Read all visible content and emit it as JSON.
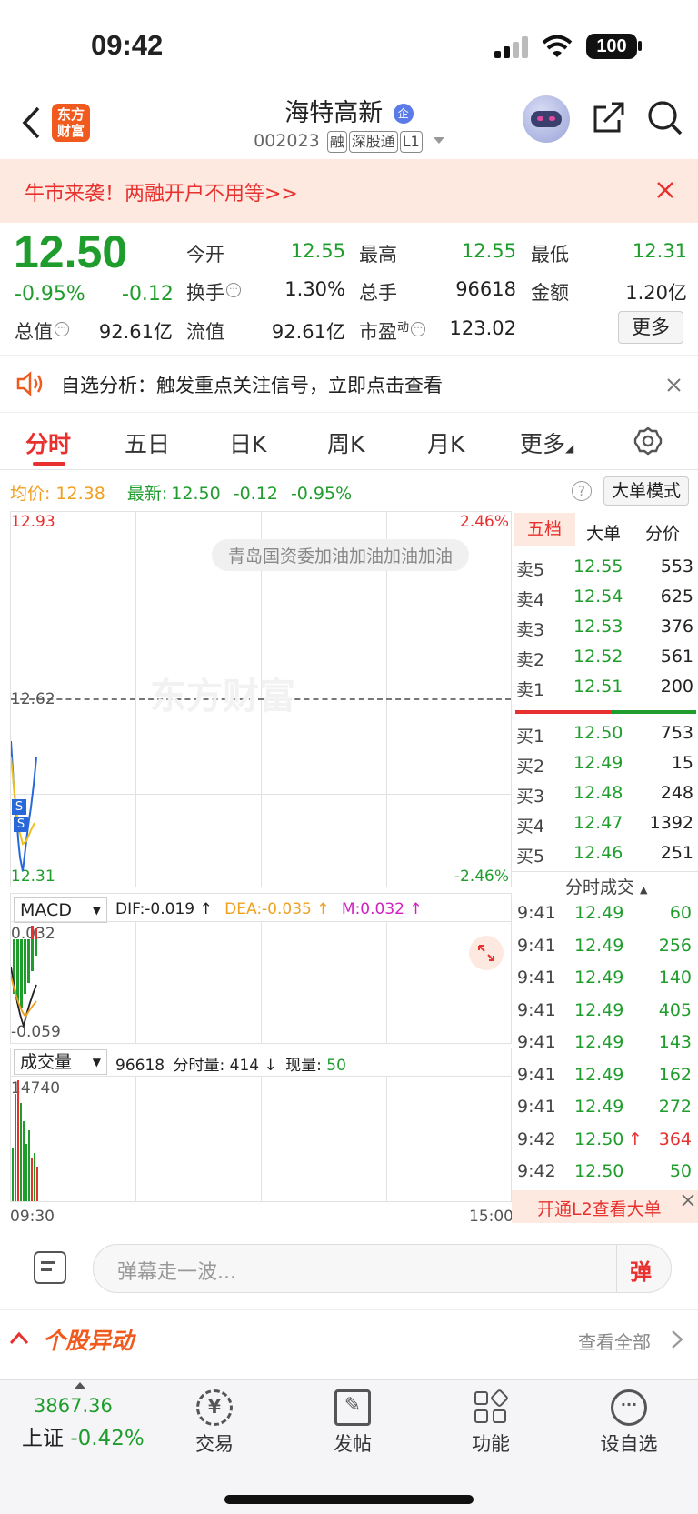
{
  "status": {
    "time": "09:42",
    "battery": "100"
  },
  "header": {
    "logo_line1": "东方",
    "logo_line2": "财富",
    "stock_name": "海特高新",
    "code": "002023",
    "tags": [
      "融",
      "深股通",
      "L1"
    ]
  },
  "banner": {
    "text": "牛市来袭！两融开户不用等>>"
  },
  "quote": {
    "price": "12.50",
    "change_pct": "-0.95%",
    "change_amt": "-0.12",
    "labels": {
      "open": "今开",
      "high": "最高",
      "low": "最低",
      "turnover": "换手",
      "volume": "总手",
      "amount": "金额",
      "mcap": "总值",
      "float_mcap": "流值",
      "pe": "市盈",
      "pe_sup": "动"
    },
    "open": "12.55",
    "high": "12.55",
    "low": "12.31",
    "turnover": "1.30%",
    "volume": "96618",
    "amount": "1.20亿",
    "mcap": "92.61亿",
    "float_mcap": "92.61亿",
    "pe": "123.02",
    "more_button": "更多"
  },
  "notice": {
    "text": "自选分析：触发重点关注信号，立即点击查看"
  },
  "tabs": [
    "分时",
    "五日",
    "日K",
    "周K",
    "月K",
    "更多"
  ],
  "chart_info": {
    "avg_label": "均价:",
    "avg_value": "12.38",
    "latest_label": "最新:",
    "latest_value": "12.50",
    "latest_change": "-0.12",
    "latest_pct": "-0.95%",
    "big_order_mode": "大单模式",
    "y_top": "12.93",
    "y_mid": "12.62",
    "y_bottom": "12.31",
    "pct_top": "2.46%",
    "pct_bottom": "-2.46%",
    "danmaku": "青岛国资委加油加油加油加油",
    "watermark": "东方财富",
    "time_start": "09:30",
    "time_end": "15:00"
  },
  "macd": {
    "selector": "MACD",
    "dif": "DIF:-0.019 ↑",
    "dea": "DEA:-0.035 ↑",
    "m": "M:0.032 ↑",
    "top": "0.032",
    "bottom": "-0.059"
  },
  "volume_panel": {
    "selector": "成交量",
    "total": "96618",
    "minute_vol": "分时量: 414 ↓",
    "current_label": "现量:",
    "current": "50",
    "top": "14740"
  },
  "orderbook": {
    "tabs": [
      "五档",
      "大单",
      "分价"
    ],
    "asks": [
      {
        "label": "卖5",
        "price": "12.55",
        "vol": "553"
      },
      {
        "label": "卖4",
        "price": "12.54",
        "vol": "625"
      },
      {
        "label": "卖3",
        "price": "12.53",
        "vol": "376"
      },
      {
        "label": "卖2",
        "price": "12.52",
        "vol": "561"
      },
      {
        "label": "卖1",
        "price": "12.51",
        "vol": "200"
      }
    ],
    "bids": [
      {
        "label": "买1",
        "price": "12.50",
        "vol": "753"
      },
      {
        "label": "买2",
        "price": "12.49",
        "vol": "15"
      },
      {
        "label": "买3",
        "price": "12.48",
        "vol": "248"
      },
      {
        "label": "买4",
        "price": "12.47",
        "vol": "1392"
      },
      {
        "label": "买5",
        "price": "12.46",
        "vol": "251"
      }
    ]
  },
  "trades": {
    "title": "分时成交",
    "rows": [
      {
        "t": "9:41",
        "p": "12.49",
        "v": "60"
      },
      {
        "t": "9:41",
        "p": "12.49",
        "v": "256"
      },
      {
        "t": "9:41",
        "p": "12.49",
        "v": "140"
      },
      {
        "t": "9:41",
        "p": "12.49",
        "v": "405"
      },
      {
        "t": "9:41",
        "p": "12.49",
        "v": "143"
      },
      {
        "t": "9:41",
        "p": "12.49",
        "v": "162"
      },
      {
        "t": "9:41",
        "p": "12.49",
        "v": "272"
      },
      {
        "t": "9:42",
        "p": "12.50",
        "v": "364"
      },
      {
        "t": "9:42",
        "p": "12.50",
        "v": "50"
      }
    ],
    "l2_text": "开通L2查看大单"
  },
  "comment": {
    "placeholder": "弹幕走一波...",
    "button": "弹"
  },
  "section": {
    "title": "个股异动",
    "view_all": "查看全部"
  },
  "nav": {
    "index_value": "3867.36",
    "index_name": "上证",
    "index_pct": "-0.42%",
    "items": [
      "交易",
      "发帖",
      "功能",
      "设自选"
    ]
  }
}
